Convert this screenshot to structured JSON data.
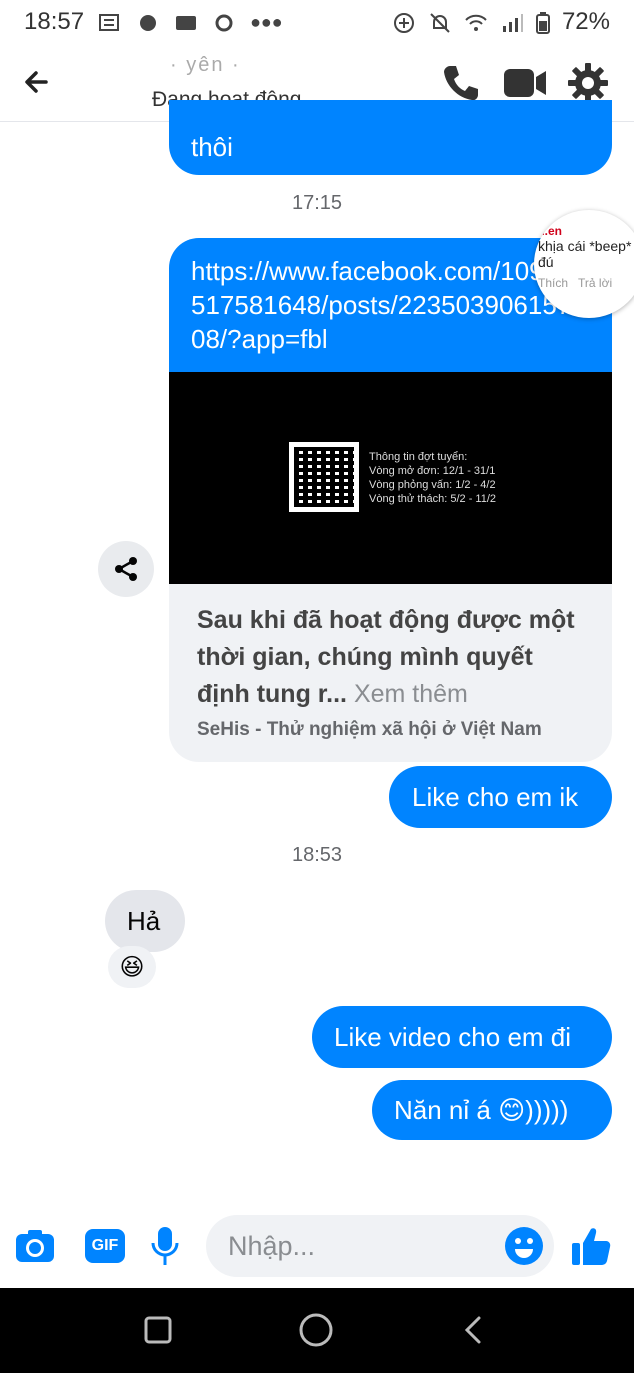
{
  "status_bar": {
    "time": "18:57",
    "battery": "72%"
  },
  "header": {
    "contact_name": "· yên ·",
    "contact_status": "Đang hoạt động"
  },
  "messages": {
    "out_1": "thôi",
    "time_1": "17:15",
    "link": {
      "url": "https://www.facebook.com/109259517581648/posts/223503906157208/?app=fbl",
      "image_lines": [
        "Thông tin đợt tuyển:",
        "Vòng mở đơn: 12/1 - 31/1",
        "Vòng phỏng vấn: 1/2 - 4/2",
        "Vòng thử thách: 5/2 - 11/2"
      ],
      "description": "Sau khi đã hoạt động được một thời gian, chúng mình quyết định tung r...",
      "see_more": "Xem thêm",
      "source": "SeHis - Thử nghiệm xã hội ở Việt Nam"
    },
    "out_2": "Like cho em ik",
    "time_2": "18:53",
    "in_1": "Hả",
    "in_1_reaction": "😆",
    "out_3": "Like video cho em đi",
    "out_4": "Năn nỉ á 😊)))))"
  },
  "popup": {
    "line1": "...en",
    "line2": "khịa cái *beep*",
    "line3": "đú",
    "like": "Thích",
    "reply": "Trả lời"
  },
  "composer": {
    "placeholder": "Nhập...",
    "gif_label": "GIF"
  },
  "colors": {
    "accent": "#0084ff",
    "incoming": "#e4e6eb"
  }
}
